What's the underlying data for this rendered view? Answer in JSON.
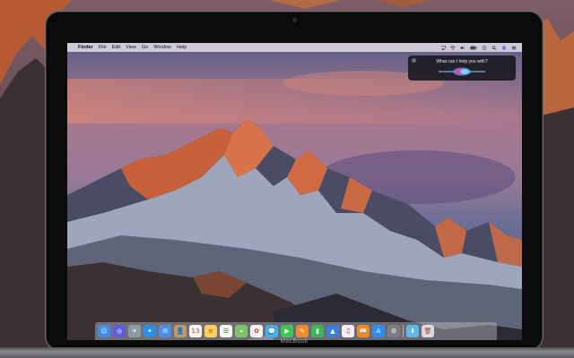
{
  "menubar": {
    "app_name": "Finder",
    "items": [
      "File",
      "Edit",
      "View",
      "Go",
      "Window",
      "Help"
    ]
  },
  "siri": {
    "prompt": "What can I help you with?"
  },
  "device_label": "MacBook",
  "dock": {
    "apps": [
      {
        "name": "finder-icon",
        "color": "#3f8ee8",
        "glyph": "☺"
      },
      {
        "name": "siri-icon",
        "color": "#5b5fd6",
        "glyph": "◎"
      },
      {
        "name": "launchpad-icon",
        "color": "#8e9aa6",
        "glyph": "✈"
      },
      {
        "name": "safari-icon",
        "color": "#2d8fe0",
        "glyph": "✦"
      },
      {
        "name": "mail-icon",
        "color": "#4a8fe6",
        "glyph": "✉"
      },
      {
        "name": "contacts-icon",
        "color": "#c39a62",
        "glyph": "👤"
      },
      {
        "name": "calendar-icon",
        "color": "#f4f4f4",
        "glyph": "13"
      },
      {
        "name": "notes-icon",
        "color": "#f3d35a",
        "glyph": "≡"
      },
      {
        "name": "reminders-icon",
        "color": "#f7f7f7",
        "glyph": "☰"
      },
      {
        "name": "maps-icon",
        "color": "#7cc46a",
        "glyph": "⌖"
      },
      {
        "name": "photos-icon",
        "color": "#f2f2f2",
        "glyph": "✿"
      },
      {
        "name": "messages-icon",
        "color": "#3fb0f0",
        "glyph": "💬"
      },
      {
        "name": "facetime-icon",
        "color": "#3cc65a",
        "glyph": "▶"
      },
      {
        "name": "pages-icon",
        "color": "#f08a2a",
        "glyph": "✎"
      },
      {
        "name": "numbers-icon",
        "color": "#3cb65a",
        "glyph": "▮"
      },
      {
        "name": "keynote-icon",
        "color": "#3a7fdc",
        "glyph": "▲"
      },
      {
        "name": "itunes-icon",
        "color": "#f0f0f4",
        "glyph": "♫"
      },
      {
        "name": "ibooks-icon",
        "color": "#f28a1e",
        "glyph": "📖"
      },
      {
        "name": "app-store-icon",
        "color": "#2f8ef0",
        "glyph": "A"
      },
      {
        "name": "system-preferences-icon",
        "color": "#7c7c82",
        "glyph": "⚙"
      }
    ],
    "folders": [
      {
        "name": "downloads-folder-icon",
        "color": "#5fb8ea",
        "glyph": "⬇"
      },
      {
        "name": "trash-icon",
        "color": "#d8dadf",
        "glyph": "🗑"
      }
    ]
  }
}
